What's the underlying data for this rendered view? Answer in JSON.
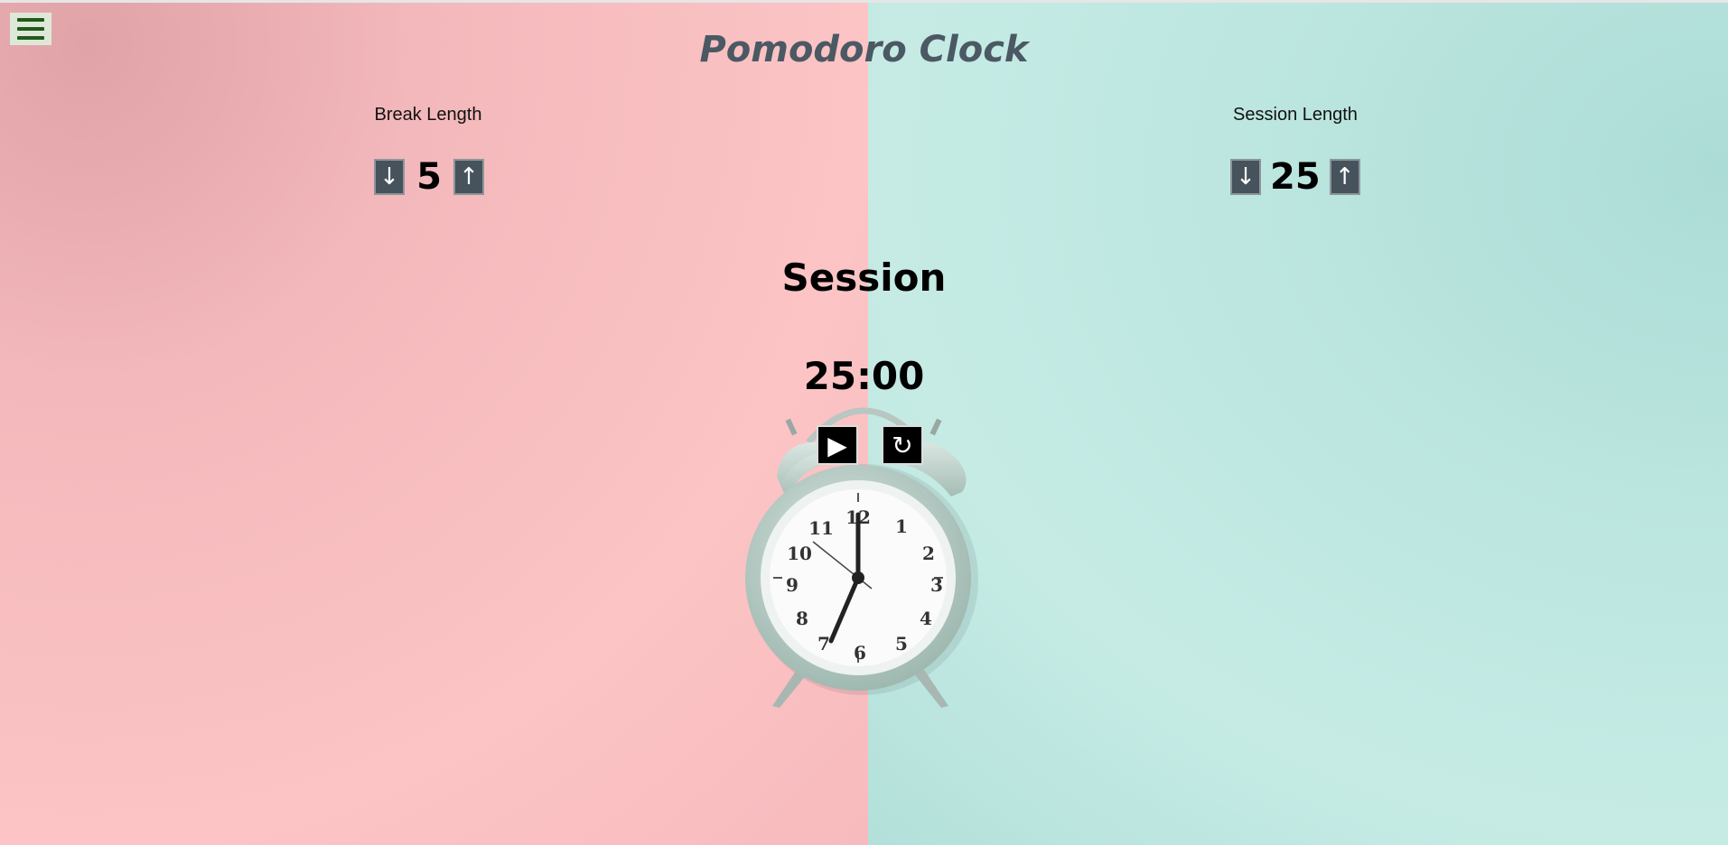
{
  "app": {
    "title": "Pomodoro Clock"
  },
  "menu": {
    "icon": "hamburger-menu-icon",
    "color": "#1f5a1a"
  },
  "break": {
    "label": "Break Length",
    "value": "5",
    "decrement_icon": "↓",
    "increment_icon": "↑"
  },
  "session": {
    "label": "Session Length",
    "value": "25",
    "decrement_icon": "↓",
    "increment_icon": "↑"
  },
  "timer": {
    "label": "Session",
    "time_left": "25:00"
  },
  "controls": {
    "start_stop_icon": "▶",
    "reset_icon": "↻"
  },
  "colors": {
    "left_bg": "#fcc4c5",
    "right_bg": "#c6ebe5",
    "button_bg": "#46525c",
    "title": "#4a5963"
  }
}
